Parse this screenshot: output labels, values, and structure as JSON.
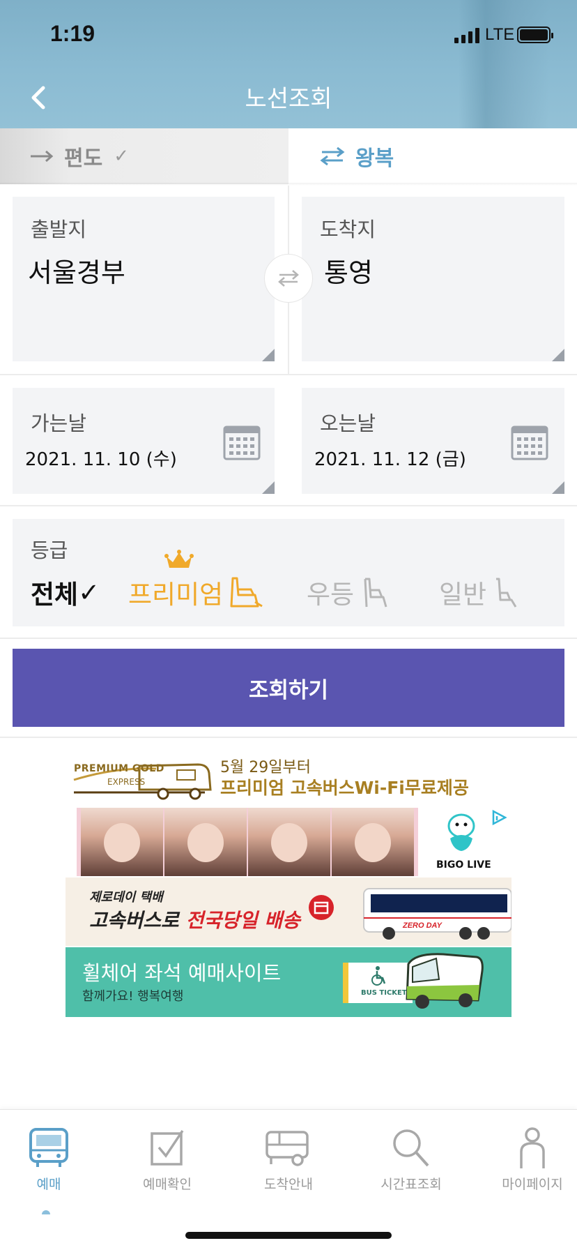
{
  "status_bar": {
    "time": "1:19",
    "network": "LTE"
  },
  "header": {
    "title": "노선조회"
  },
  "trip_tabs": {
    "oneway_label": "편도",
    "oneway_check": "✓",
    "round_label": "왕복"
  },
  "departure": {
    "label": "출발지",
    "value": "서울경부"
  },
  "arrival": {
    "label": "도착지",
    "value": "통영"
  },
  "go_date": {
    "label": "가는날",
    "value": "2021. 11. 10 (수)"
  },
  "return_date": {
    "label": "오는날",
    "value": "2021. 11. 12 (금)"
  },
  "grade": {
    "label": "등급",
    "options": [
      "전체",
      "프리미엄",
      "우등",
      "일반"
    ],
    "selected_check": "✓"
  },
  "search_button": "조회하기",
  "ads": {
    "premium": {
      "logo_text": "PREMIUM GOLD",
      "logo_sub": "EXPRESS",
      "line1": "5월 29일부터",
      "line2": "프리미엄 고속버스Wi-Fi무료제공",
      "bigo": "BIGO LIVE"
    },
    "zeroday": {
      "small": "제로데이 택배",
      "big_prefix": "고속버스로 ",
      "big_highlight": "전국당일 배송",
      "bus_text": "ZERO DAY"
    },
    "wheelchair": {
      "title": "휠체어 좌석 예매사이트",
      "subtitle": "함께가요! 행복여행",
      "ticket": "BUS TICKET"
    }
  },
  "bottom_nav": [
    {
      "label": "예매",
      "icon": "bus-icon",
      "active": true
    },
    {
      "label": "예매확인",
      "icon": "checkbox-icon",
      "active": false
    },
    {
      "label": "도착안내",
      "icon": "truck-icon",
      "active": false
    },
    {
      "label": "시간표조회",
      "icon": "search-icon",
      "active": false
    },
    {
      "label": "마이페이지",
      "icon": "person-icon",
      "active": false
    }
  ],
  "colors": {
    "header": "#8bbbd2",
    "accent_blue": "#5a9fc8",
    "search_button": "#5a55b0",
    "premium": "#f0a92a",
    "card_bg": "#f3f4f6"
  }
}
